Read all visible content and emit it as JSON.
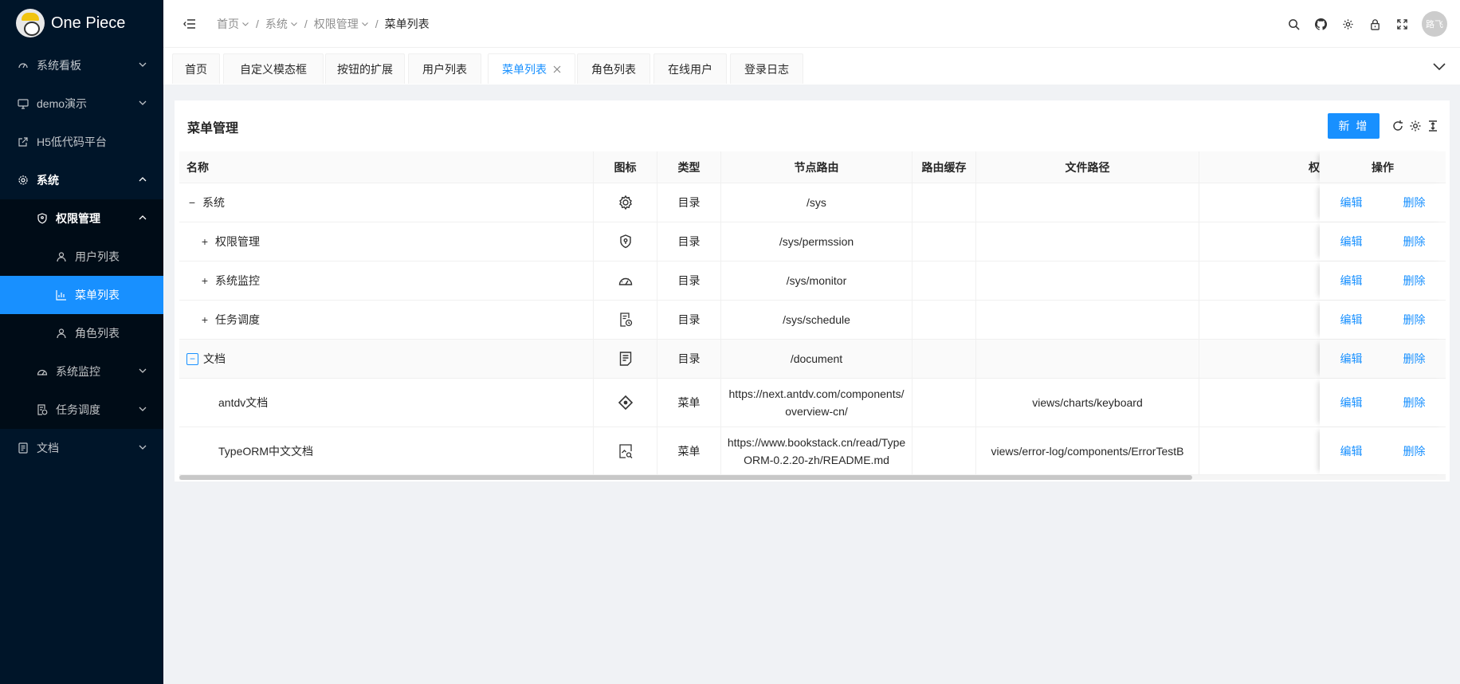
{
  "app": {
    "title": "One Piece"
  },
  "sidebar": {
    "items": [
      {
        "label": "系统看板",
        "icon": "dashboard-icon"
      },
      {
        "label": "demo演示",
        "icon": "desktop-icon"
      },
      {
        "label": "H5低代码平台",
        "icon": "external-link-icon"
      },
      {
        "label": "系统",
        "icon": "gear-icon"
      },
      {
        "label": "权限管理",
        "icon": "shield-icon"
      },
      {
        "label": "用户列表",
        "icon": "user-icon"
      },
      {
        "label": "菜单列表",
        "icon": "chart-icon"
      },
      {
        "label": "角色列表",
        "icon": "user-icon"
      },
      {
        "label": "系统监控",
        "icon": "gauge-icon"
      },
      {
        "label": "任务调度",
        "icon": "schedule-icon"
      },
      {
        "label": "文档",
        "icon": "document-icon"
      }
    ]
  },
  "breadcrumb": {
    "items": [
      "首页",
      "系统",
      "权限管理",
      "菜单列表"
    ]
  },
  "header": {
    "avatar_text": "路飞"
  },
  "tabs": [
    "首页",
    "自定义模态框",
    "按钮的扩展",
    "用户列表",
    "菜单列表",
    "角色列表",
    "在线用户",
    "登录日志"
  ],
  "card": {
    "title": "菜单管理",
    "add_button": "新 增"
  },
  "table": {
    "headers": {
      "name": "名称",
      "icon": "图标",
      "type": "类型",
      "route": "节点路由",
      "cache": "路由缓存",
      "path": "文件路径",
      "perm": "权",
      "ops": "操作"
    },
    "rows": [
      {
        "name": "系统",
        "icon": "gear-icon",
        "type": "目录",
        "route": "/sys",
        "path": "",
        "edit": "编辑",
        "del": "删除"
      },
      {
        "name": "权限管理",
        "icon": "shield-icon",
        "type": "目录",
        "route": "/sys/permssion",
        "path": "",
        "edit": "编辑",
        "del": "删除"
      },
      {
        "name": "系统监控",
        "icon": "gauge-icon",
        "type": "目录",
        "route": "/sys/monitor",
        "path": "",
        "edit": "编辑",
        "del": "删除"
      },
      {
        "name": "任务调度",
        "icon": "schedule-icon",
        "type": "目录",
        "route": "/sys/schedule",
        "path": "",
        "edit": "编辑",
        "del": "删除"
      },
      {
        "name": "文档",
        "icon": "document-icon",
        "type": "目录",
        "route": "/document",
        "path": "",
        "edit": "编辑",
        "del": "删除"
      },
      {
        "name": "antdv文档",
        "icon": "antd-icon",
        "type": "菜单",
        "route": "https://next.antdv.com/components/overview-cn/",
        "path": "views/charts/keyboard",
        "edit": "编辑",
        "del": "删除"
      },
      {
        "name": "TypeORM中文文档",
        "icon": "file-search-icon",
        "type": "菜单",
        "route": "https://www.bookstack.cn/read/TypeORM-0.2.20-zh/README.md",
        "path": "views/error-log/components/ErrorTestB",
        "edit": "编辑",
        "del": "删除"
      }
    ]
  },
  "scroll_position": 0.8
}
